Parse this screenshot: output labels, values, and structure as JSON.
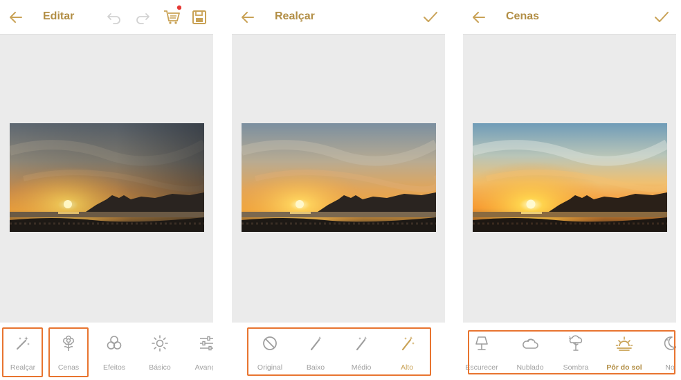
{
  "colors": {
    "accent": "#c9a256",
    "title": "#b28e45",
    "icon_muted": "#9e9e9e",
    "icon_disabled": "#d2d2d2",
    "label_muted": "#a0a0a0",
    "highlight": "#e8742f",
    "notification": "#e53935",
    "canvas": "#ebebeb"
  },
  "panels": [
    {
      "title": "Editar",
      "header_icons": [
        "arrow-left-icon",
        "undo-icon",
        "redo-icon",
        "cart-icon",
        "save-icon"
      ],
      "tools": [
        {
          "label": "Realçar",
          "icon": "magic-wand-icon",
          "selected": false
        },
        {
          "label": "Cenas",
          "icon": "flower-icon",
          "selected": false
        },
        {
          "label": "Efeitos",
          "icon": "circles-icon",
          "selected": false
        },
        {
          "label": "Básico",
          "icon": "sun-icon",
          "selected": false
        },
        {
          "label": "Avança",
          "icon": "sliders-icon",
          "selected": false
        }
      ]
    },
    {
      "title": "Realçar",
      "header_icons": [
        "arrow-left-icon",
        "check-icon"
      ],
      "tools": [
        {
          "label": "Original",
          "icon": "no-sign-icon",
          "selected": false
        },
        {
          "label": "Baixo",
          "icon": "wand-low-icon",
          "selected": false
        },
        {
          "label": "Médio",
          "icon": "wand-medium-icon",
          "selected": false
        },
        {
          "label": "Alto",
          "icon": "wand-high-icon",
          "selected": true
        }
      ]
    },
    {
      "title": "Cenas",
      "header_icons": [
        "arrow-left-icon",
        "check-icon"
      ],
      "tools": [
        {
          "label": "Escurecer",
          "icon": "lamp-icon",
          "selected": false
        },
        {
          "label": "Nublado",
          "icon": "cloud-icon",
          "selected": false
        },
        {
          "label": "Sombra",
          "icon": "tree-icon",
          "selected": false
        },
        {
          "label": "Pôr do sol",
          "icon": "sunset-icon",
          "selected": true
        },
        {
          "label": "No",
          "icon": "moon-icon",
          "selected": false
        }
      ]
    }
  ]
}
